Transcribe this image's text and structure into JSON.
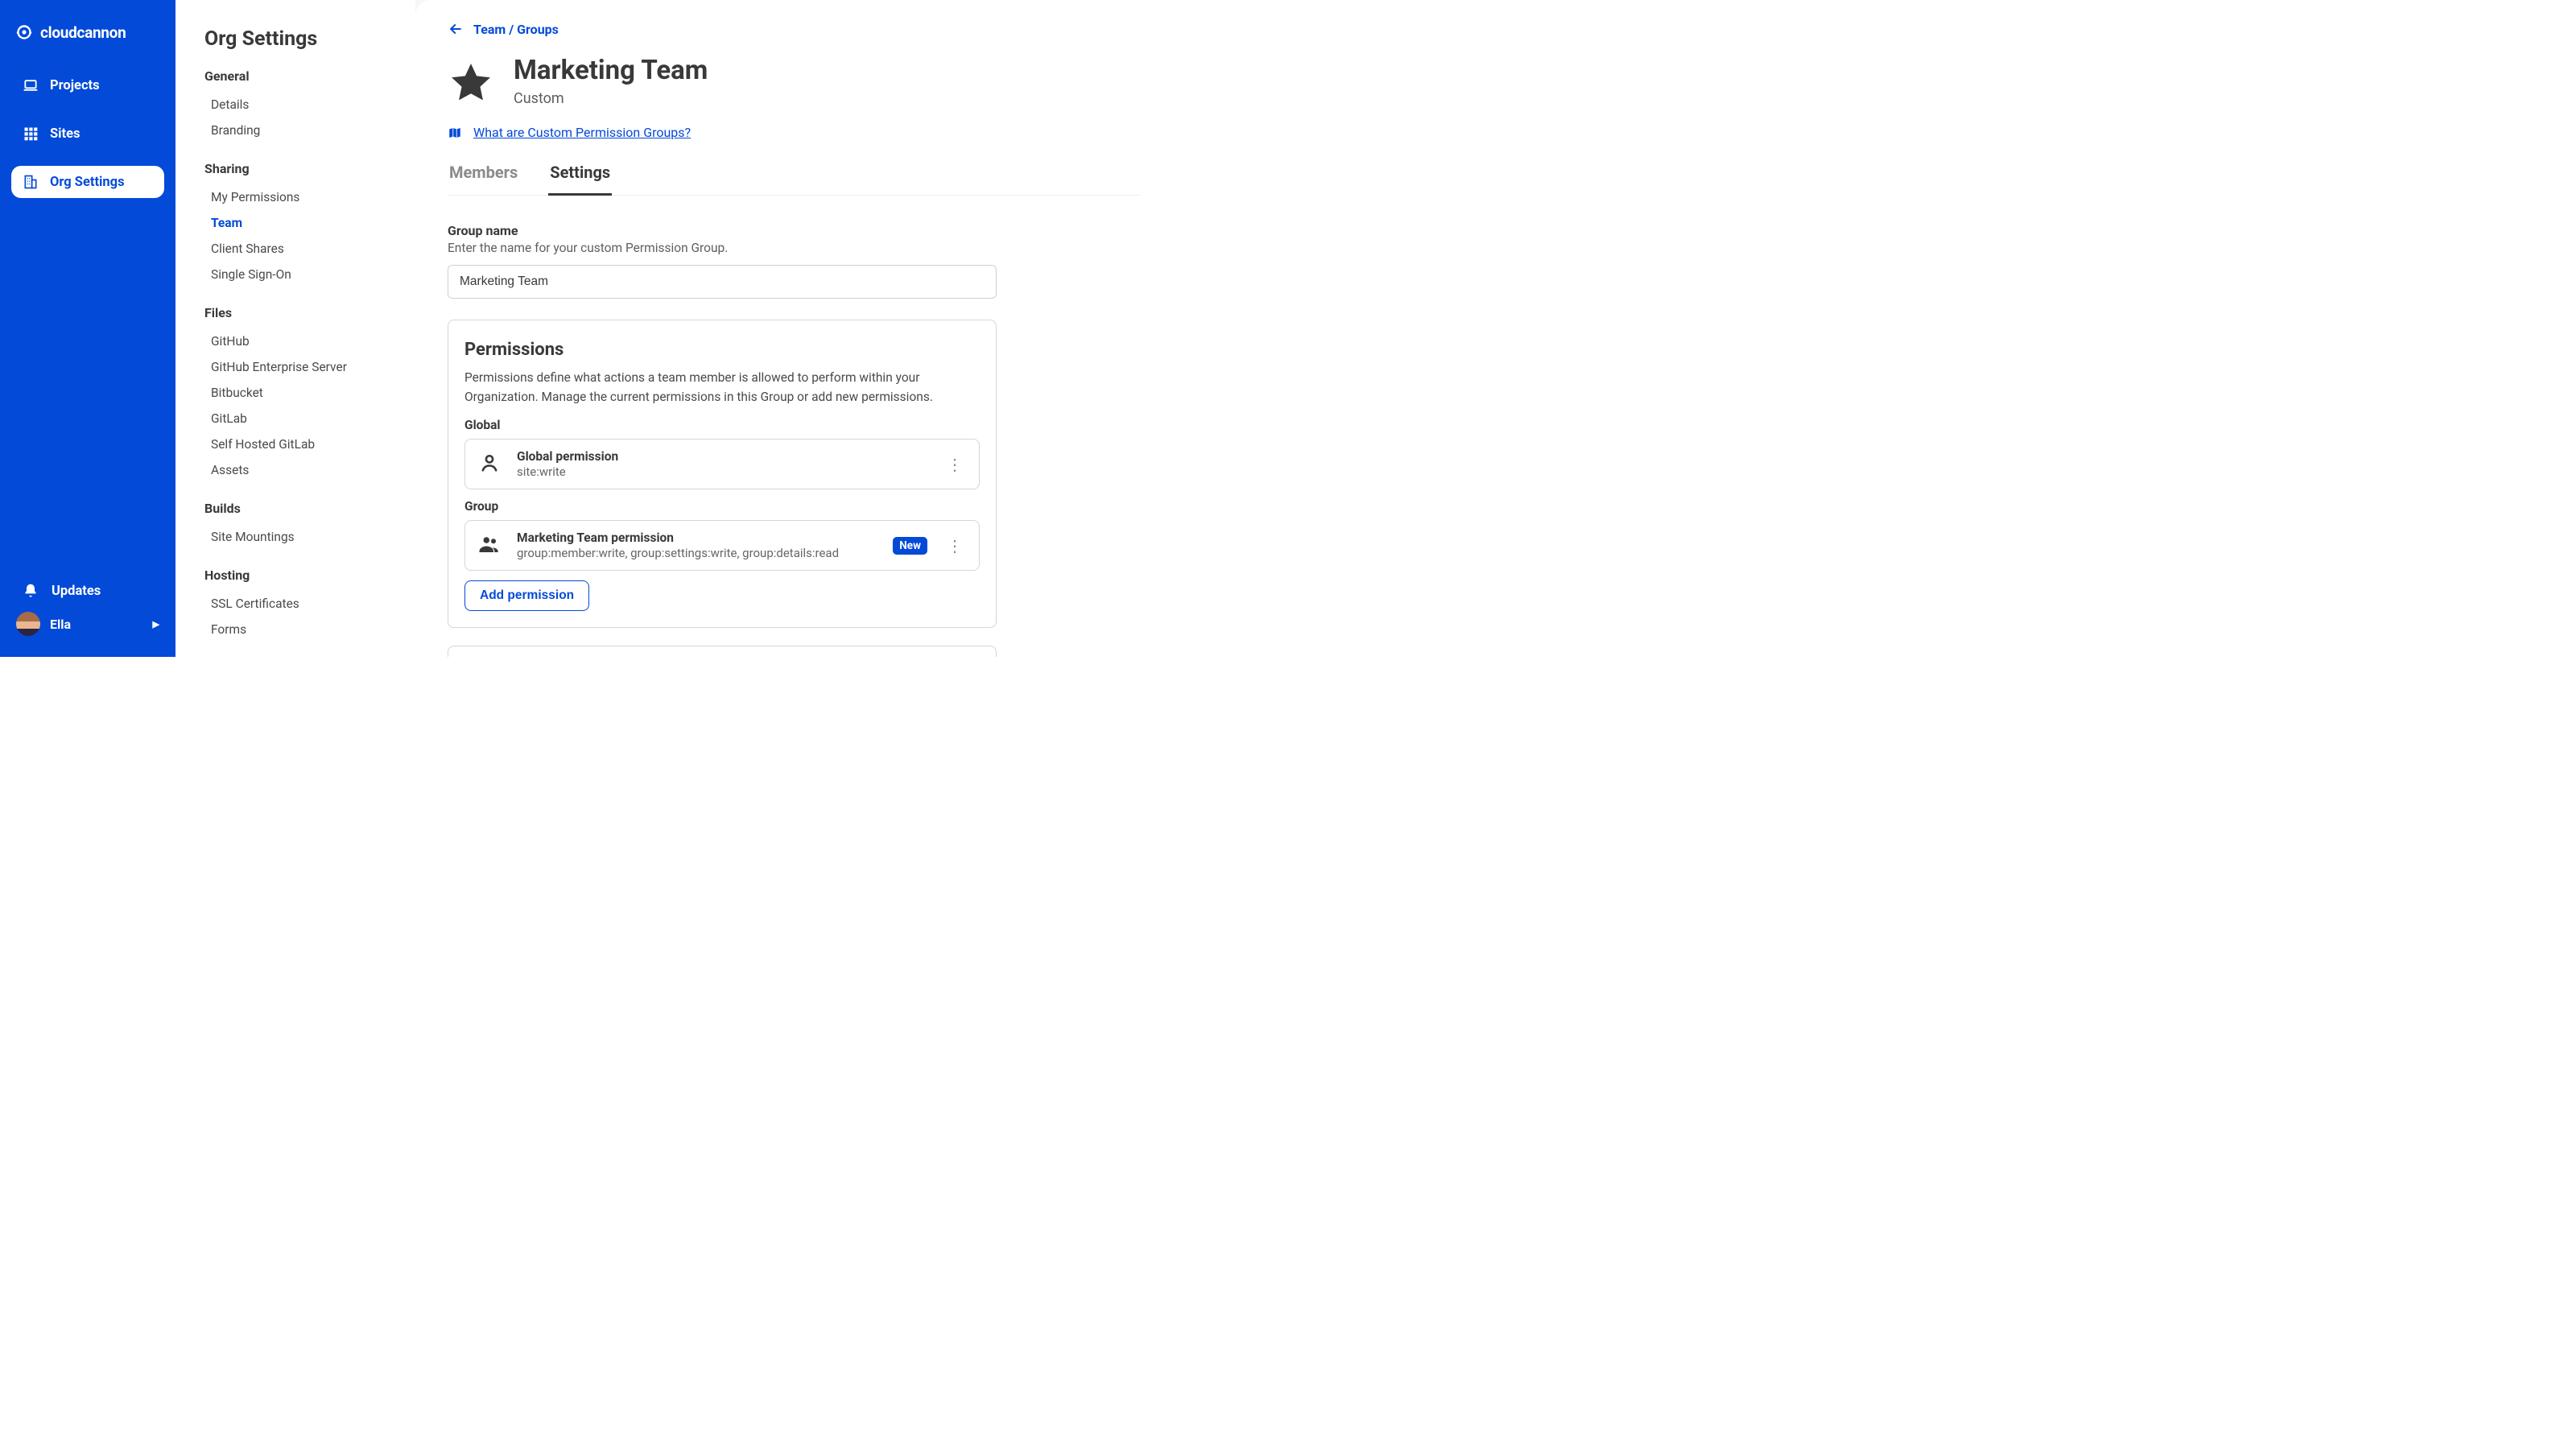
{
  "brand": {
    "name": "cloudcannon"
  },
  "rail": {
    "projects": "Projects",
    "sites": "Sites",
    "org_settings": "Org Settings",
    "updates": "Updates",
    "user": "Ella"
  },
  "sidebar": {
    "title": "Org Settings",
    "groups": [
      {
        "label": "General",
        "items": [
          "Details",
          "Branding"
        ]
      },
      {
        "label": "Sharing",
        "items": [
          "My Permissions",
          "Team",
          "Client Shares",
          "Single Sign-On"
        ],
        "active": "Team"
      },
      {
        "label": "Files",
        "items": [
          "GitHub",
          "GitHub Enterprise Server",
          "Bitbucket",
          "GitLab",
          "Self Hosted GitLab",
          "Assets"
        ]
      },
      {
        "label": "Builds",
        "items": [
          "Site Mountings"
        ]
      },
      {
        "label": "Hosting",
        "items": [
          "SSL Certificates",
          "Forms"
        ]
      }
    ]
  },
  "breadcrumb": "Team / Groups",
  "page": {
    "title": "Marketing Team",
    "subtitle": "Custom"
  },
  "help": "What are Custom Permission Groups?",
  "tabs": {
    "members": "Members",
    "settings": "Settings",
    "active": "settings"
  },
  "group_name": {
    "label": "Group name",
    "hint": "Enter the name for your custom Permission Group.",
    "value": "Marketing Team"
  },
  "permissions": {
    "heading": "Permissions",
    "desc": "Permissions define what actions a team member is allowed to perform within your Organization. Manage the current permissions in this Group or add new permissions.",
    "sections": [
      {
        "label": "Global",
        "rows": [
          {
            "title": "Global permission",
            "meta": "site:write"
          }
        ]
      },
      {
        "label": "Group",
        "rows": [
          {
            "title": "Marketing Team permission",
            "meta": "group:member:write, group:settings:write, group:details:read",
            "badge": "New"
          }
        ]
      }
    ],
    "add_label": "Add permission"
  }
}
